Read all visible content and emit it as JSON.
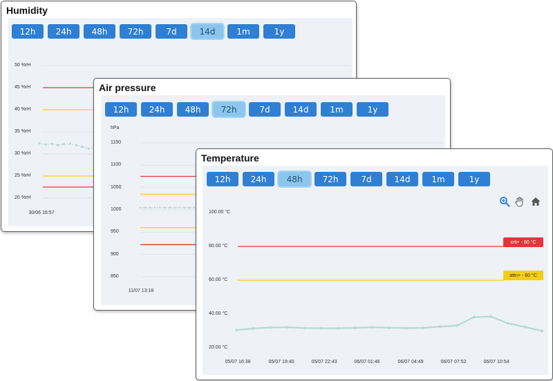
{
  "colors": {
    "button": "#2f7fd4",
    "button_selected": "#8cc5ee",
    "crit": "#d93a3a",
    "attn": "#f5cc16",
    "series": "#b9d9d6",
    "chart_bg": "#eef2f6"
  },
  "humidity": {
    "title": "Humidity",
    "ranges": [
      "12h",
      "24h",
      "48h",
      "72h",
      "7d",
      "14d",
      "1m",
      "1y"
    ],
    "selected": "14d",
    "x_ticks": [
      "30/06 16:57"
    ]
  },
  "pressure": {
    "title": "Air pressure",
    "ranges": [
      "12h",
      "24h",
      "48h",
      "72h",
      "7d",
      "14d",
      "1m",
      "1y"
    ],
    "selected": "72h",
    "y_unit": "hPa",
    "x_ticks": [
      "11/07 13:18"
    ]
  },
  "temperature": {
    "title": "Temperature",
    "ranges": [
      "12h",
      "24h",
      "48h",
      "72h",
      "7d",
      "14d",
      "1m",
      "1y"
    ],
    "selected": "48h",
    "crit_label": "crit+ - 80 °C",
    "attn_label": "attn+ - 60 °C",
    "tools": [
      "zoom-in-icon",
      "pan-hand-icon",
      "home-icon"
    ]
  },
  "chart_data": [
    {
      "type": "line",
      "title": "Humidity",
      "y_ticks": [
        "20 %rH",
        "25 %rH",
        "30 %rH",
        "35 %rH",
        "40 %rH",
        "45 %rH",
        "50 %rH"
      ],
      "ylim": [
        20,
        50
      ],
      "grid": true,
      "thresholds": [
        {
          "kind": "crit",
          "value": 45
        },
        {
          "kind": "attn",
          "value": 40
        },
        {
          "kind": "attn",
          "value": 25
        },
        {
          "kind": "crit",
          "value": 22.5
        }
      ],
      "series": [
        {
          "values": [
            32.4,
            32.1,
            32.3,
            32.0,
            32.2,
            32.3,
            32.0,
            31.6,
            31.2,
            31.5
          ]
        }
      ]
    },
    {
      "type": "line",
      "title": "Air pressure",
      "y_ticks": [
        "850",
        "900",
        "950",
        "1000",
        "1050",
        "1100",
        "1150"
      ],
      "ylim": [
        850,
        1150
      ],
      "grid": true,
      "thresholds": [
        {
          "kind": "crit",
          "value": 1075
        },
        {
          "kind": "attn",
          "value": 1035
        },
        {
          "kind": "attn",
          "value": 960
        },
        {
          "kind": "crit",
          "value": 922
        }
      ],
      "series": [
        {
          "values": [
            1005,
            1005,
            1005,
            1005,
            1005,
            1005,
            1005,
            1005,
            1005,
            1005,
            1005,
            1005
          ]
        }
      ]
    },
    {
      "type": "line",
      "title": "Temperature",
      "categories": [
        "05/07 16:38",
        "05/07 19:40",
        "05/07 22:43",
        "06/07 01:46",
        "06/07 04:49",
        "06/07 07:52",
        "06/07 10:54"
      ],
      "y_ticks": [
        "20.00 °C",
        "40.00 °C",
        "60.00 °C",
        "80.00 °C",
        "100.00 °C"
      ],
      "ylim": [
        20,
        100
      ],
      "grid": false,
      "thresholds": [
        {
          "kind": "crit",
          "value": 80
        },
        {
          "kind": "attn",
          "value": 60
        }
      ],
      "series": [
        {
          "values": [
            30.5,
            31.5,
            32,
            32.2,
            31.7,
            31.6,
            31.6,
            31.8,
            32.2,
            31.9,
            31.7,
            31.8,
            32.6,
            33.2,
            38.2,
            38.5,
            34.5,
            32.4,
            30
          ]
        }
      ]
    }
  ]
}
